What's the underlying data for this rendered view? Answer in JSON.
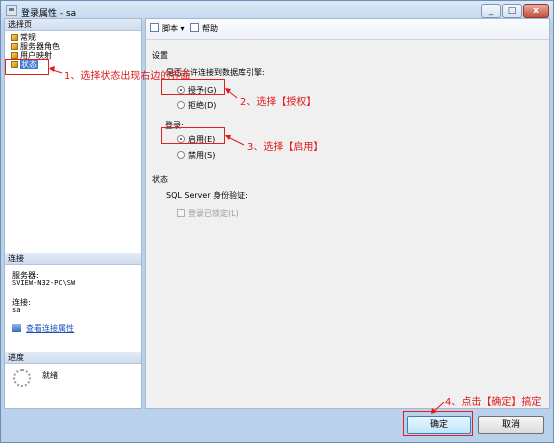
{
  "window": {
    "title": "登录属性 - sa",
    "controls": [
      "_",
      "□",
      "x"
    ]
  },
  "left": {
    "select_page_header": "选择页",
    "pages": [
      {
        "label": "常规",
        "selected": false
      },
      {
        "label": "服务器角色",
        "selected": false
      },
      {
        "label": "用户映射",
        "selected": false
      },
      {
        "label": "状态",
        "selected": true
      }
    ],
    "connection_header": "连接",
    "server_label": "服务器:",
    "server_value": "SVIEW-N32-PC\\SW",
    "connection_label": "连接:",
    "connection_value": "sa",
    "view_properties_link": "查看连接属性",
    "progress_header": "进度",
    "progress_status": "就绪"
  },
  "toolbar": {
    "script_label": "脚本",
    "help_label": "帮助"
  },
  "settings": {
    "heading": "设置",
    "permission_label": "是否允许连接到数据库引擎:",
    "grant_label": "授予(G)",
    "deny_label": "拒绝(D)",
    "login_label": "登录:",
    "enabled_label": "启用(E)",
    "disabled_label": "禁用(S)",
    "status_heading": "状态",
    "sql_auth_label": "SQL Server 身份验证:",
    "locked_label": "登录已锁定(L)"
  },
  "buttons": {
    "ok": "确定",
    "cancel": "取消"
  },
  "annotations": {
    "step1": "1、选择状态出现右边的界面",
    "step2": "2、选择【授权】",
    "step3": "3、选择【启用】",
    "step4": "4、点击【确定】搞定"
  },
  "colors": {
    "annotation": "#e01818",
    "selection": "#3f79d2"
  }
}
